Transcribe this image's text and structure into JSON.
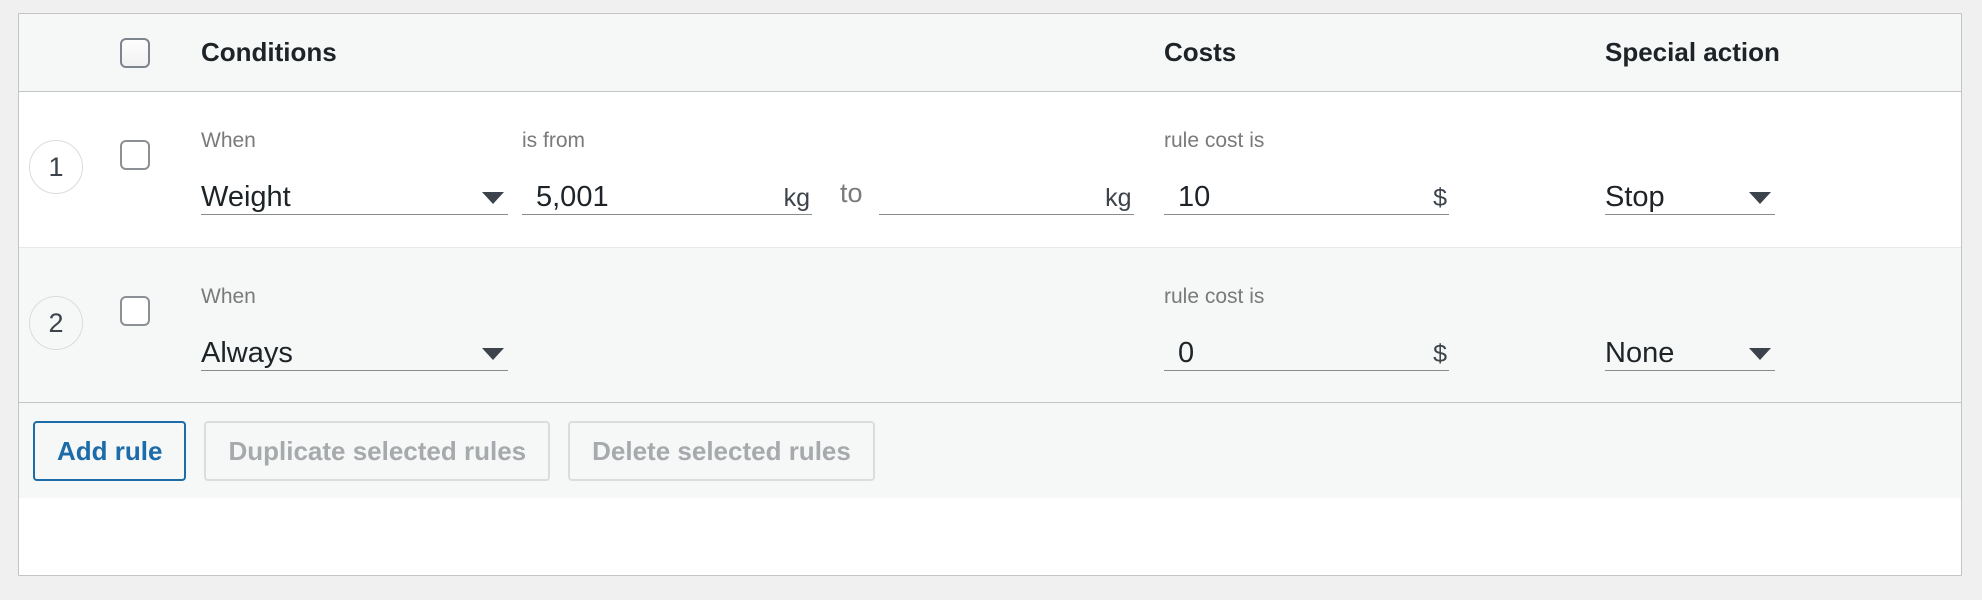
{
  "table": {
    "header": {
      "select_all_checkbox": "select-all",
      "columns": [
        {
          "key": "conditions",
          "label": "Conditions"
        },
        {
          "key": "costs",
          "label": "Costs"
        },
        {
          "key": "special_action",
          "label": "Special action"
        }
      ]
    },
    "labels": {
      "when": "When",
      "is_from": "is from",
      "to": "to",
      "rule_cost_is": "rule cost is"
    },
    "rows": [
      {
        "number": "1",
        "selected": false,
        "when_value": "Weight",
        "from_value": "5,001",
        "from_unit": "kg",
        "to_value": "",
        "to_unit": "kg",
        "cost_value": "10",
        "cost_unit": "$",
        "action_value": "Stop",
        "show_range": true
      },
      {
        "number": "2",
        "selected": false,
        "when_value": "Always",
        "from_value": "",
        "from_unit": "",
        "to_value": "",
        "to_unit": "",
        "cost_value": "0",
        "cost_unit": "$",
        "action_value": "None",
        "show_range": false
      }
    ]
  },
  "footer": {
    "add_rule": "Add rule",
    "duplicate_selected": "Duplicate selected rules",
    "delete_selected": "Delete selected rules"
  },
  "colors": {
    "accent": "#1b6ca8",
    "panel_border": "#c3c4c7",
    "header_bg": "#f6f7f7",
    "row_alt_bg": "#f6f7f7",
    "disabled_text": "#a7aaad",
    "label_text": "#7a7a7a",
    "value_text": "#1d2327"
  }
}
